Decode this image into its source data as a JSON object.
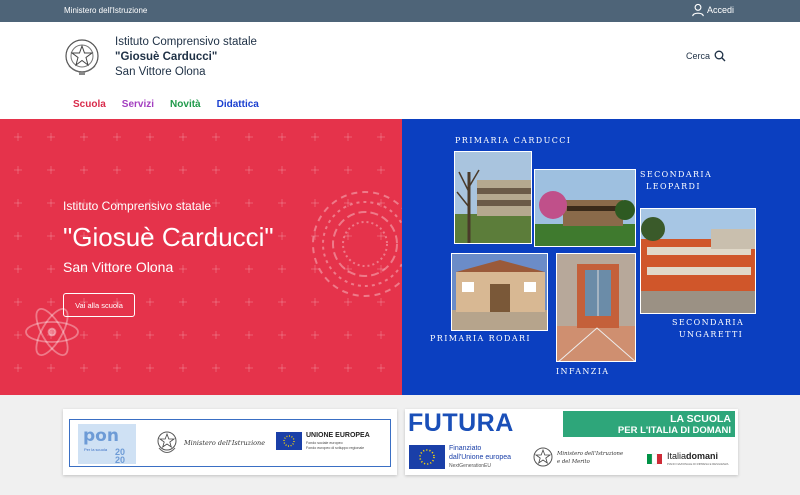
{
  "topbar": {
    "ministry": "Ministero dell'Istruzione",
    "login": "Accedi",
    "login_icon": "user-icon"
  },
  "header": {
    "line1": "Istituto Comprensivo statale",
    "line2": "\"Giosuè Carducci\"",
    "line3": "San Vittore Olona",
    "search_label": "Cerca",
    "search_icon": "search-icon"
  },
  "nav": [
    {
      "label": "Scuola",
      "color": "#d92b4b"
    },
    {
      "label": "Servizi",
      "color": "#a33fc0"
    },
    {
      "label": "Novità",
      "color": "#1f9a4a"
    },
    {
      "label": "Didattica",
      "color": "#1a3fd0"
    }
  ],
  "hero": {
    "subtitle": "Istituto Comprensivo statale",
    "title": "\"Giosuè Carducci\"",
    "town": "San Vittore Olona",
    "button": "Vai alla scuola",
    "left_color": "#e5334b",
    "right_color": "#0b3fc0"
  },
  "collage": {
    "primaria_carducci": "PRIMARIA CARDUCCI",
    "secondaria_leopardi_1": "SECONDARIA",
    "secondaria_leopardi_2": "LEOPARDI",
    "secondaria_ungaretti_1": "SECONDARIA",
    "secondaria_ungaretti_2": "UNGARETTI",
    "primaria_rodari": "PRIMARIA RODARI",
    "infanzia": "INFANZIA"
  },
  "logos": {
    "pon": "pon",
    "pon_sub": "Per la scuola",
    "pon_year": "20",
    "pon_year_2": "20",
    "ministero": "Ministero dell'Istruzione",
    "ue": "UNIONE EUROPEA",
    "ue_sub1": "Fondo sociale europeo",
    "ue_sub2": "Fondo europeo di sviluppo regionale",
    "futura": "FUTURA",
    "scuola_italia_1": "LA SCUOLA",
    "scuola_italia_2": "PER L'ITALIA DI DOMANI",
    "finanziato_1": "Finanziato",
    "finanziato_2": "dall'Unione europea",
    "finanziato_3": "NextGenerationEU",
    "ministero_merito_1": "Ministero dell'Istruzione",
    "ministero_merito_2": "e del Merito",
    "italiadomani_a": "Italia",
    "italiadomani_b": "domani",
    "italiadomani_sub": "PIANO NAZIONALE DI RIPRESA E RESILIENZA"
  }
}
